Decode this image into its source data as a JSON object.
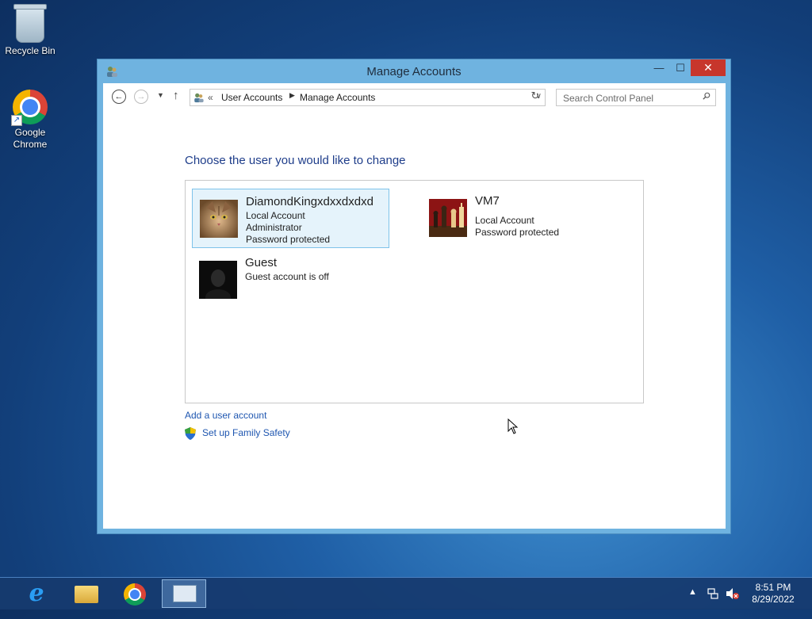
{
  "desktop": {
    "icons": [
      {
        "label": "Recycle Bin"
      },
      {
        "label": "Google Chrome"
      }
    ]
  },
  "window": {
    "title": "Manage Accounts",
    "controls": {
      "minimize": "—",
      "maximize": "☐",
      "close": "✕"
    }
  },
  "nav": {
    "back": "←",
    "forward": "→",
    "up": "↑",
    "address": {
      "overflow": "«",
      "crumbs": [
        "User Accounts",
        "Manage Accounts"
      ],
      "separator": "▶"
    },
    "refresh": "↻",
    "search_placeholder": "Search Control Panel"
  },
  "main": {
    "heading": "Choose the user you would like to change",
    "accounts": [
      {
        "name": "DiamondKingxdxxdxdxd",
        "lines": [
          "Local Account",
          "Administrator",
          "Password protected"
        ],
        "avatar": "cat-avatar",
        "selected": true
      },
      {
        "name": "VM7",
        "lines": [
          "Local Account",
          "Password protected"
        ],
        "avatar": "chess-avatar",
        "selected": false
      },
      {
        "name": "Guest",
        "lines": [
          "Guest account is off"
        ],
        "avatar": "guest-avatar",
        "selected": false
      }
    ],
    "links": {
      "add_account": "Add a user account",
      "family_safety": "Set up Family Safety"
    }
  },
  "taskbar": {
    "items": [
      "internet-explorer-icon",
      "file-explorer-icon",
      "chrome-icon",
      "control-panel-icon"
    ],
    "tray": {
      "show_hidden": "▲"
    },
    "clock": {
      "time": "8:51 PM",
      "date": "8/29/2022"
    }
  },
  "colors": {
    "titlebar": "#6fb3e0",
    "close_button": "#c7362c",
    "heading": "#1e3d8a",
    "link": "#1e56b0",
    "selection": "#e5f3fb"
  }
}
